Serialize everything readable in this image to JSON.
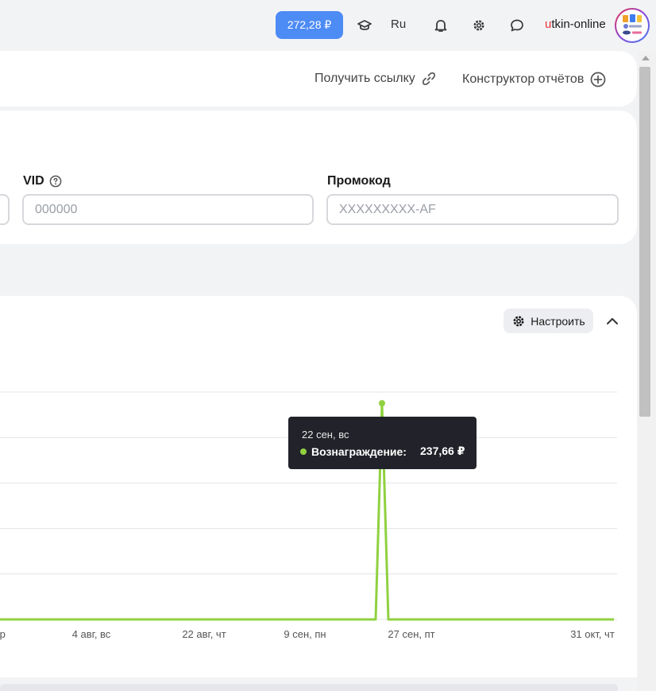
{
  "header": {
    "balance": "272,28 ₽",
    "lang": "Ru",
    "user_accent": "u",
    "user_rest": "tkin-online",
    "icons": [
      "graduation-cap-icon",
      "bell-icon",
      "gear-icon",
      "chat-icon"
    ]
  },
  "toolbar": {
    "get_link": "Получить ссылку",
    "report_builder": "Конструктор отчётов"
  },
  "filters": {
    "vid_label": "VID",
    "vid_placeholder": "000000",
    "promo_label": "Промокод",
    "promo_placeholder": "XXXXXXXXX-AF"
  },
  "chart_panel": {
    "setup_label": "Настроить"
  },
  "tooltip": {
    "date": "22 сен, вс",
    "series": "Вознаграждение:",
    "value": "237,66 ₽",
    "color": "#8fd13f"
  },
  "chart_data": {
    "type": "line",
    "x_tick_labels": [
      "ср",
      "4 авг, вс",
      "22 авг, чт",
      "9 сен, пн",
      "27 сен, пт",
      "31 окт, чт"
    ],
    "series": [
      {
        "name": "Вознаграждение",
        "color": "#8fd13f",
        "points": [
          {
            "x": "ср",
            "y": 0
          },
          {
            "x": "4 авг, вс",
            "y": 0
          },
          {
            "x": "22 авг, чт",
            "y": 0
          },
          {
            "x": "9 сен, пн",
            "y": 0
          },
          {
            "x": "21 сен",
            "y": 0
          },
          {
            "x": "22 сен, вс",
            "y": 237.66
          },
          {
            "x": "23 сен",
            "y": 0
          },
          {
            "x": "27 сен, пт",
            "y": 0
          },
          {
            "x": "31 окт, чт",
            "y": 0
          }
        ]
      }
    ],
    "grid": true
  }
}
